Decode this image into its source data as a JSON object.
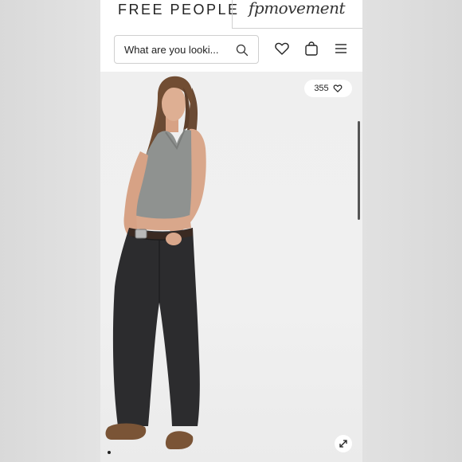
{
  "header": {
    "brand": "FREE PEOPLE",
    "sub_brand": "fpmovement"
  },
  "search": {
    "placeholder": "What are you looki..."
  },
  "icons": {
    "search": "search-icon",
    "wishlist": "heart-icon",
    "bag": "shopping-bag-icon",
    "menu": "hamburger-menu-icon",
    "expand": "expand-icon"
  },
  "product": {
    "likes_count": "355",
    "image_alt": "Model wearing grey ribbed tank top, black baggy jeans with western belt and brown moccasins"
  },
  "colors": {
    "background": "#d9d9d9",
    "product_bg": "#efefef",
    "text": "#222222"
  }
}
